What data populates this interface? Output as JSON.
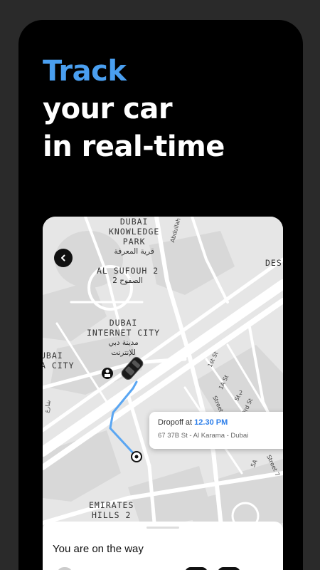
{
  "headline": {
    "accent": "Track",
    "line2": "your car",
    "line3": "in real-time"
  },
  "colors": {
    "accent": "#4a9ff0",
    "route": "#5aa6f2",
    "dropoff_time": "#2b7de9",
    "background": "#000000",
    "map": "#e8e8e8"
  },
  "map": {
    "labels": {
      "knowledge_park_1": "DUBAI",
      "knowledge_park_2": "KNOWLEDGE",
      "knowledge_park_3": "PARK",
      "knowledge_park_ar": "قرية المعرفة",
      "al_sufouh_1": "AL SUFOUH 2",
      "al_sufouh_ar": "الصفوح 2",
      "internet_city_1": "DUBAI",
      "internet_city_2": "INTERNET CITY",
      "internet_city_ar1": "مدينة دبي",
      "internet_city_ar2": "للإنترنت",
      "media_city_1": "UBAI",
      "media_city_2": "A CITY",
      "emirates_hills_1": "EMIRATES",
      "emirates_hills_2": "HILLS 2",
      "des": "DES",
      "abdullah_omran": "Abdullah Omran"
    },
    "streets": {
      "s1": "1st St",
      "s2": "1A St",
      "s3": "Street 1",
      "s4": "3rd St",
      "s5": "5A",
      "s6": "Street 7",
      "s7": "St",
      "s8": "2",
      "ar_side": "شارع"
    }
  },
  "back_icon": "chevron-left-icon",
  "dropoff": {
    "label": "Dropoff at",
    "time": "12.30 PM",
    "address": "67 37B St - Al Karama - Dubai",
    "chevron_icon": "chevron-right-icon"
  },
  "sheet": {
    "title": "You are on the way"
  }
}
